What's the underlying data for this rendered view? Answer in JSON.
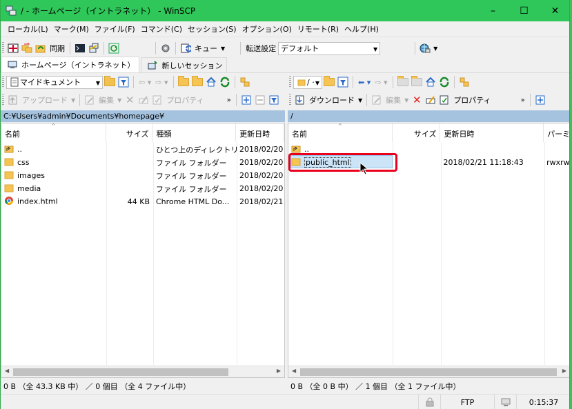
{
  "window": {
    "title": "/ - ホームページ（イントラネット） - WinSCP",
    "controls": [
      "–",
      "☐",
      "✕"
    ]
  },
  "menu": [
    "ローカル(L)",
    "マーク(M)",
    "ファイル(F)",
    "コマンド(C)",
    "セッション(S)",
    "オプション(O)",
    "リモート(R)",
    "ヘルプ(H)"
  ],
  "toolbar": {
    "sync_label": "同期",
    "queue_label": "キュー",
    "transfer_settings_label": "転送設定",
    "transfer_settings_value": "デフォルト"
  },
  "tabs": {
    "session_tab": "ホームページ（イントラネット）",
    "new_session": "新しいセッション"
  },
  "local": {
    "location_combo": "マイドキュメント",
    "upload_label": "アップロード",
    "edit_label": "編集",
    "properties_label": "プロパティ",
    "path": "C:¥Users¥admin¥Documents¥homepage¥",
    "columns": [
      "名前",
      "サイズ",
      "種類",
      "更新日時"
    ],
    "rows": [
      {
        "name": "..",
        "size": "",
        "type": "ひとつ上のディレクトリ",
        "date": "2018/02/20"
      },
      {
        "name": "css",
        "size": "",
        "type": "ファイル フォルダー",
        "date": "2018/02/20"
      },
      {
        "name": "images",
        "size": "",
        "type": "ファイル フォルダー",
        "date": "2018/02/20"
      },
      {
        "name": "media",
        "size": "",
        "type": "ファイル フォルダー",
        "date": "2018/02/20"
      },
      {
        "name": "index.html",
        "size": "44 KB",
        "type": "Chrome HTML Do...",
        "date": "2018/02/21"
      }
    ],
    "status": "0 B （全 43.3 KB 中） ／ 0 個目 （全 4 ファイル中）"
  },
  "remote": {
    "location_combo": "/ ·",
    "download_label": "ダウンロード",
    "edit_label": "編集",
    "properties_label": "プロパティ",
    "path": "/",
    "columns": [
      "名前",
      "サイズ",
      "更新日時",
      "パーミッ"
    ],
    "rows": [
      {
        "name": "..",
        "size": "",
        "date": "",
        "perm": ""
      },
      {
        "name": "public_html",
        "size": "",
        "date": "2018/02/21 11:18:43",
        "perm": "rwxrw"
      }
    ],
    "status": "0 B （全 0 B 中） ／ 1 個目 （全 1 ファイル中）"
  },
  "statusbar": {
    "protocol": "FTP",
    "time": "0:15:37"
  },
  "colors": {
    "titlebar": "#2fc759",
    "path_bar": "#a5c3df",
    "selection": "#cce4f7",
    "highlight": "#e8001c"
  }
}
